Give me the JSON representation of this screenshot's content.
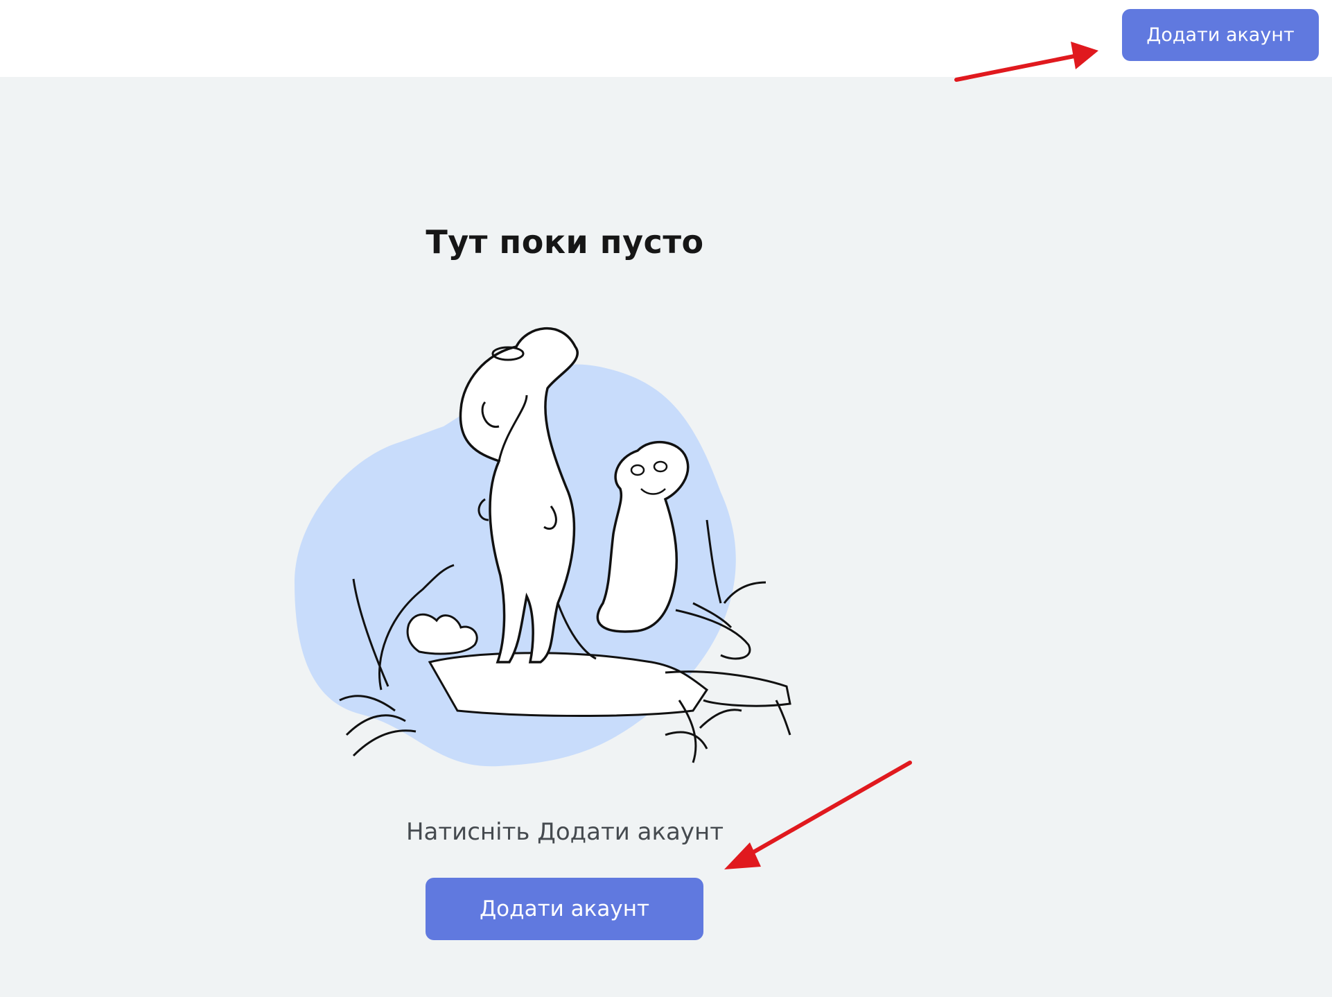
{
  "header": {
    "add_account_button": "Додати акаунт"
  },
  "empty_state": {
    "title": "Тут поки пусто",
    "hint": "Натисніть  Додати акаунт",
    "add_account_button": "Додати акаунт",
    "illustration": "meerkats-illustration"
  },
  "annotations": [
    {
      "type": "arrow",
      "color": "#e0191e",
      "target": "header-add-account-button"
    },
    {
      "type": "arrow",
      "color": "#e0191e",
      "target": "main-add-account-button"
    }
  ],
  "colors": {
    "accent": "#6079df",
    "background": "#f0f3f4",
    "header_background": "#ffffff",
    "illustration_blob": "#c8dcfb",
    "annotation_red": "#e0191e"
  }
}
